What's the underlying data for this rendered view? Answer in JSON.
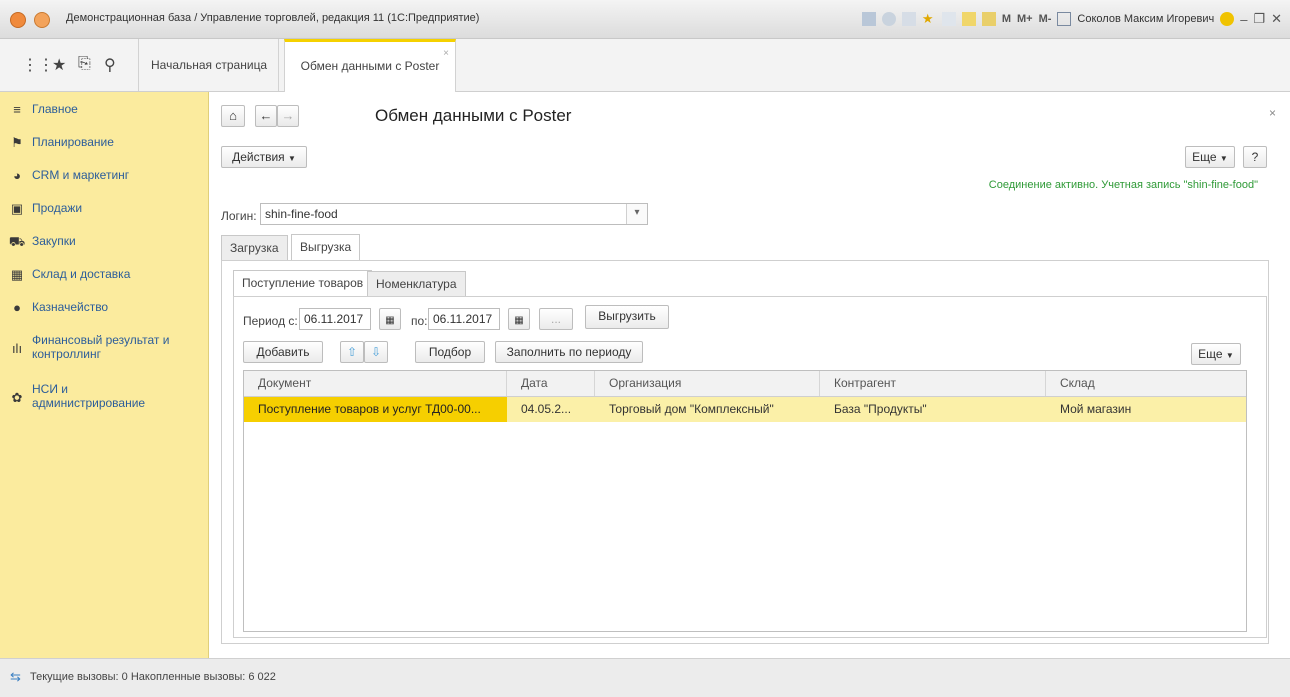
{
  "window": {
    "title": "Демонстрационная база / Управление торговлей, редакция 11  (1С:Предприятие)",
    "toolbar": [
      "M",
      "M+",
      "M-"
    ],
    "user": "Соколов Максим Игоревич"
  },
  "tabs": {
    "home": "Начальная страница",
    "active": "Обмен данными с Poster"
  },
  "sidebar": {
    "items": [
      {
        "label": "Главное",
        "icon": "menu-icon"
      },
      {
        "label": "Планирование",
        "icon": "planning-icon"
      },
      {
        "label": "CRM и маркетинг",
        "icon": "pie-chart-icon"
      },
      {
        "label": "Продажи",
        "icon": "shopping-bag-icon"
      },
      {
        "label": "Закупки",
        "icon": "cart-icon"
      },
      {
        "label": "Склад и доставка",
        "icon": "warehouse-icon"
      },
      {
        "label": "Казначейство",
        "icon": "coin-icon"
      },
      {
        "label": "Финансовый результат и контроллинг",
        "icon": "bar-chart-icon"
      },
      {
        "label": "НСИ и администрирование",
        "icon": "gear-icon"
      }
    ]
  },
  "form": {
    "title": "Обмен данными с Poster",
    "actions_label": "Действия",
    "more_label": "Еще",
    "help_label": "?",
    "connection_status": "Соединение активно. Учетная запись \"shin-fine-food\"",
    "login_label": "Логин:",
    "login_value": "shin-fine-food",
    "tabs": [
      "Загрузка",
      "Выгрузка"
    ],
    "subtabs": [
      "Поступление товаров",
      "Номенклатура"
    ],
    "period_from_label": "Период с:",
    "period_from": "06.11.2017",
    "period_to_label": "по:",
    "period_to": "06.11.2017",
    "ellipsis_label": "...",
    "export_label": "Выгрузить",
    "add_label": "Добавить",
    "pick_label": "Подбор",
    "fill_label": "Заполнить по периоду",
    "table_more_label": "Еще"
  },
  "table": {
    "columns": [
      "Документ",
      "Дата",
      "Организация",
      "Контрагент",
      "Склад"
    ],
    "rows": [
      [
        "Поступление товаров и услуг ТД00-00...",
        "04.05.2...",
        "Торговый дом \"Комплексный\"",
        "База \"Продукты\"",
        "Мой магазин"
      ]
    ]
  },
  "statusbar": {
    "text": "Текущие вызовы: 0   Накопленные вызовы: 6 022"
  },
  "colors": {
    "sidebar_bg": "#fbeb9e",
    "selected_row": "#f6cf00",
    "row_highlight": "#fbf0a8",
    "status_ok": "#2f9a37"
  }
}
